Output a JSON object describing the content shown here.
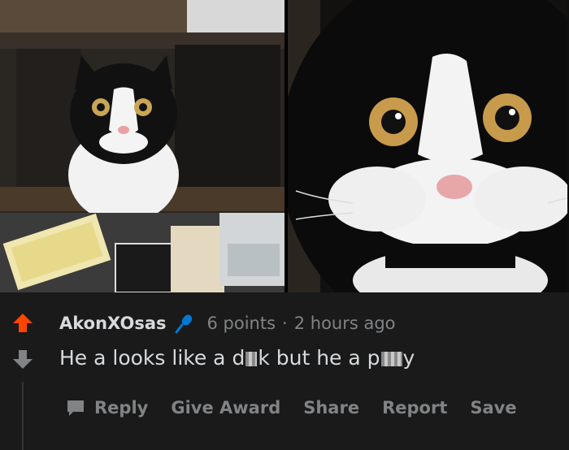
{
  "comment": {
    "author": "AkonXOsas",
    "points": "6 points",
    "separator": "·",
    "time": "2 hours ago",
    "text_part1": "He a looks like a d",
    "text_part2": "k but he a p",
    "text_part3": "y",
    "actions": {
      "reply": "Reply",
      "give_award": "Give Award",
      "share": "Share",
      "report": "Report",
      "save": "Save"
    }
  },
  "colors": {
    "background": "#1a1a1b",
    "upvote": "#ff4500",
    "text": "#d7dadc",
    "muted": "#818384",
    "mic": "#0079d3"
  },
  "icons": [
    "upvote-arrow-icon",
    "downvote-arrow-icon",
    "microphone-icon",
    "comment-bubble-icon"
  ]
}
